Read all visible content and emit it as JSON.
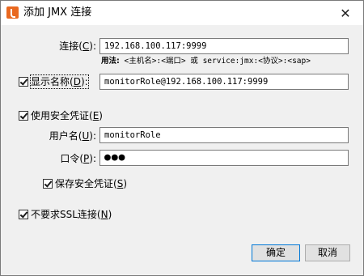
{
  "window": {
    "title": "添加 JMX 连接",
    "close_glyph": "✕"
  },
  "connection": {
    "label_text": "连接(",
    "label_key": "C",
    "label_suffix": "):",
    "value": "192.168.100.117:9999"
  },
  "usage_hint": {
    "prefix": "用法:",
    "text": " <主机名>:<端口> 或 service:jmx:<协议>:<sap>"
  },
  "display_name": {
    "checked": true,
    "label_text": "显示名称(",
    "label_key": "D",
    "label_suffix": "):",
    "value": "monitorRole@192.168.100.117:9999"
  },
  "use_security": {
    "checked": true,
    "label_text": "使用安全凭证(",
    "label_key": "E",
    "label_suffix": ")"
  },
  "username": {
    "label_text": "用户名(",
    "label_key": "U",
    "label_suffix": "):",
    "value": "monitorRole"
  },
  "password": {
    "label_text": "口令(",
    "label_key": "P",
    "label_suffix": "):",
    "mask": "●●●"
  },
  "save_credentials": {
    "checked": true,
    "label_text": "保存安全凭证(",
    "label_key": "S",
    "label_suffix": ")"
  },
  "no_ssl": {
    "checked": true,
    "label_text": "不要求SSL连接(",
    "label_key": "N",
    "label_suffix": ")"
  },
  "buttons": {
    "ok": "确定",
    "cancel": "取消"
  }
}
